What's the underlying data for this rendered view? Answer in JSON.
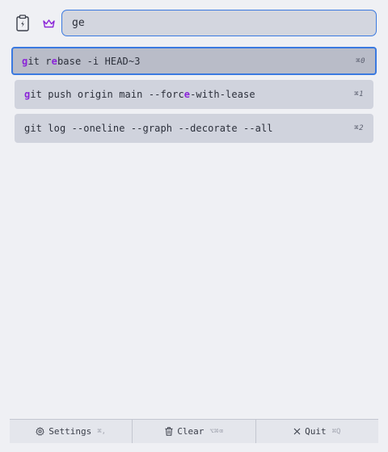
{
  "header": {
    "clipboard_icon": "clipboard-bolt-icon",
    "crown_icon": "crown-icon",
    "search": {
      "value": "ge",
      "placeholder": ""
    }
  },
  "results": [
    {
      "segments": [
        {
          "text": "g",
          "hl": true
        },
        {
          "text": "it r",
          "hl": false
        },
        {
          "text": "e",
          "hl": true
        },
        {
          "text": "base -i HEAD~3",
          "hl": false
        }
      ],
      "shortcut": "⌘0",
      "selected": true
    },
    {
      "segments": [
        {
          "text": "g",
          "hl": true
        },
        {
          "text": "it push origin main --forc",
          "hl": false
        },
        {
          "text": "e",
          "hl": true
        },
        {
          "text": "-with-lease",
          "hl": false
        }
      ],
      "shortcut": "⌘1",
      "selected": false
    },
    {
      "segments": [
        {
          "text": "git log --oneline --graph --decorate --all",
          "hl": false
        }
      ],
      "shortcut": "⌘2",
      "selected": false
    }
  ],
  "footer": {
    "settings": {
      "label": "Settings",
      "hint": "⌘,",
      "icon": "gear-icon"
    },
    "clear": {
      "label": "Clear",
      "hint": "⌥⌘⌫",
      "icon": "trash-icon"
    },
    "quit": {
      "label": "Quit",
      "hint": "⌘Q",
      "icon": "close-icon"
    }
  },
  "colors": {
    "accent": "#3a79e0",
    "highlight": "#8a24d8",
    "background": "#eff0f4",
    "row": "#d0d3dd",
    "row_selected": "#b9bcc8"
  }
}
